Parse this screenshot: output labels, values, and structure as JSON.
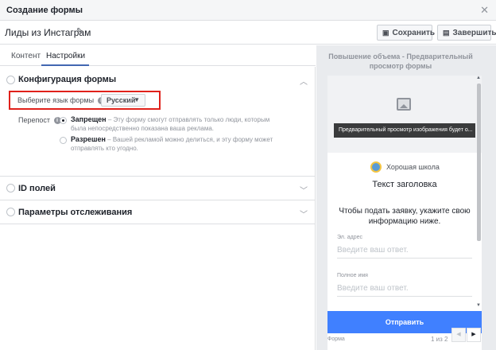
{
  "dialog": {
    "title": "Создание формы",
    "close_icon": "close-icon"
  },
  "header": {
    "form_name": "Лиды из Инстаграм",
    "save_label": "Сохранить",
    "finish_label": "Завершить"
  },
  "tabs": [
    {
      "label": "Контент",
      "active": false
    },
    {
      "label": "Настройки",
      "active": true
    }
  ],
  "settings": {
    "form_config": {
      "title": "Конфигурация формы",
      "language_label": "Выберите язык формы",
      "language_value": "Русский",
      "sharing_label": "Перепост",
      "option_forbidden_title": "Запрещен",
      "option_forbidden_desc": " – Эту форму смогут отправлять только люди, которым была непосредственно показана ваша реклама.",
      "option_allowed_title": "Разрешен",
      "option_allowed_desc": " – Вашей рекламой можно делиться, и эту форму может отправлять кто угодно."
    },
    "fields_id": {
      "title": "ID полей"
    },
    "tracking": {
      "title": "Параметры отслеживания"
    }
  },
  "preview": {
    "title": "Повышение объема - Предварительный просмотр формы",
    "image_caption": "Предварительный просмотр изображения будет о...",
    "school_name": "Хорошая школа",
    "headline": "Текст заголовка",
    "description": "Чтобы подать заявку, укажите свою информацию ниже.",
    "fields": [
      {
        "label": "Эл. адрес",
        "placeholder": "Введите ваш ответ."
      },
      {
        "label": "Полное имя",
        "placeholder": "Введите ваш ответ."
      }
    ],
    "submit_label": "Отправить",
    "footer_label": "Форма",
    "pager": "1 из 2"
  },
  "colors": {
    "accent": "#4267b2",
    "submit": "#4080ff",
    "highlight_box": "#e0211b"
  }
}
